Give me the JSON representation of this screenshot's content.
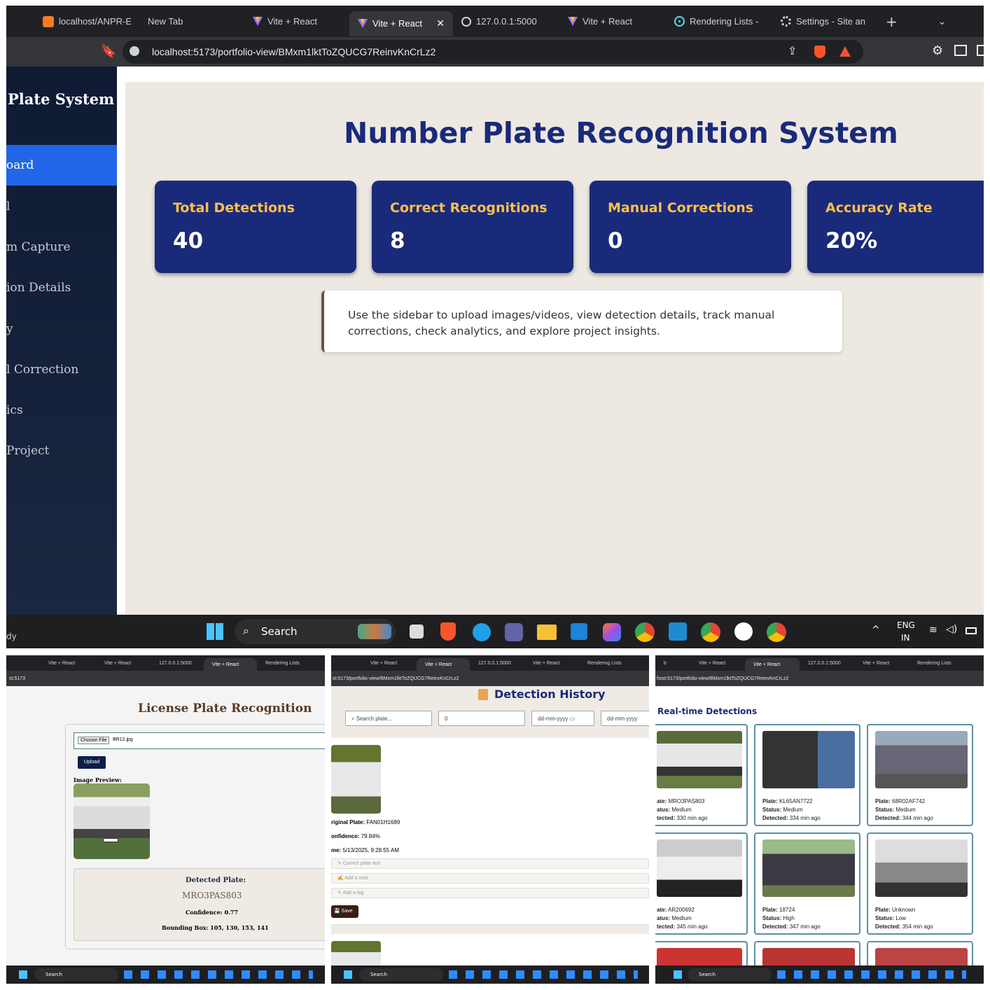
{
  "browser": {
    "tabs": [
      "localhost/ANPR-E",
      "New Tab",
      "Vite + React",
      "Vite + React",
      "127.0.0.1:5000",
      "Vite + React",
      "Rendering Lists -",
      "Settings - Site an"
    ],
    "url": "localhost:5173/portfolio-view/BMxm1lktToZQUCG7ReinvKnCrLz2"
  },
  "sidebar": {
    "title": "Plate System",
    "items": [
      "oard",
      "l",
      "m Capture",
      "ion Details",
      "y",
      "l Correction",
      "ics",
      "Project"
    ]
  },
  "main": {
    "title": "Number Plate Recognition System",
    "cards": [
      {
        "label": "Total Detections",
        "value": "40"
      },
      {
        "label": "Correct Recognitions",
        "value": "8"
      },
      {
        "label": "Manual Corrections",
        "value": "0"
      },
      {
        "label": "Accuracy Rate",
        "value": "20%"
      }
    ],
    "info": "Use the sidebar to upload images/videos, view detection details, track manual corrections, check analytics, and explore project insights."
  },
  "taskbar": {
    "left_text": "dy",
    "search": "Search",
    "lang1": "ENG",
    "lang2": "IN"
  },
  "panel1": {
    "tabs": [
      "Vite + React",
      "Vite + React",
      "127.0.0.1:5000",
      "Vite + React",
      "Rendering Lists"
    ],
    "url": "st:5173",
    "title": "License Plate Recognition",
    "choose_file": "Choose File",
    "file_name": "BR12.jpg",
    "upload": "Upload",
    "preview_label": "Image Preview:",
    "detected_label": "Detected Plate:",
    "detected_value": "MRO3PAS803",
    "confidence": "Confidence: 0.77",
    "bbox": "Bounding Box: 105, 130, 153, 141"
  },
  "panel2": {
    "tabs": [
      "Vite + React",
      "Vite + React",
      "127.0.0.1:5000",
      "Vite + React",
      "Rendering Lists"
    ],
    "url": "st:5173/portfolio-view/BMxm1lktToZQUCG7ReinvKnCrLz2",
    "title": "Detection History",
    "search_placeholder": "Search plate...",
    "num_value": "0",
    "date_placeholder": "dd-mm-yyyy",
    "original_label": "riginal Plate:",
    "original_value": "FAN01H1689",
    "confidence_label": "onfidence:",
    "confidence_value": "79.84%",
    "time_label": "me:",
    "time_value": "5/13/2025, 9:28:55 AM",
    "correct_placeholder": "Correct plate text",
    "note_placeholder": "Add a note",
    "tag_placeholder": "Add a tag",
    "save": "Save"
  },
  "panel3": {
    "tabs": [
      "b",
      "Vite + React",
      "Vite + React",
      "127.0.0.1:5000",
      "Vite + React",
      "Rendering Lists"
    ],
    "url": "host:5173/portfolio-view/BMxm1lktToZQUCG7ReinvKnCrLz2",
    "title": "Real-time Detections",
    "detections": [
      {
        "plate_label": "ate:",
        "plate": "MRO3PAS803",
        "status_label": "atus:",
        "status": "Medium",
        "det_label": "tected:",
        "detected": "330 min ago"
      },
      {
        "plate_label": "Plate:",
        "plate": "KL65AN7722",
        "status_label": "Status:",
        "status": "Medium",
        "det_label": "Detected:",
        "detected": "334 min ago"
      },
      {
        "plate_label": "Plate:",
        "plate": "68R02AF742",
        "status_label": "Status:",
        "status": "Medium",
        "det_label": "Detected:",
        "detected": "344 min ago"
      },
      {
        "plate_label": "ate:",
        "plate": "AR200692",
        "status_label": "atus:",
        "status": "Medium",
        "det_label": "tected:",
        "detected": "345 min ago"
      },
      {
        "plate_label": "Plate:",
        "plate": "18724",
        "status_label": "Status:",
        "status": "High",
        "det_label": "Detected:",
        "detected": "347 min ago"
      },
      {
        "plate_label": "Plate:",
        "plate": "Unknown",
        "status_label": "Status:",
        "status": "Low",
        "det_label": "Detected:",
        "detected": "354 min ago"
      }
    ]
  },
  "mini_taskbar": {
    "search": "Search"
  }
}
